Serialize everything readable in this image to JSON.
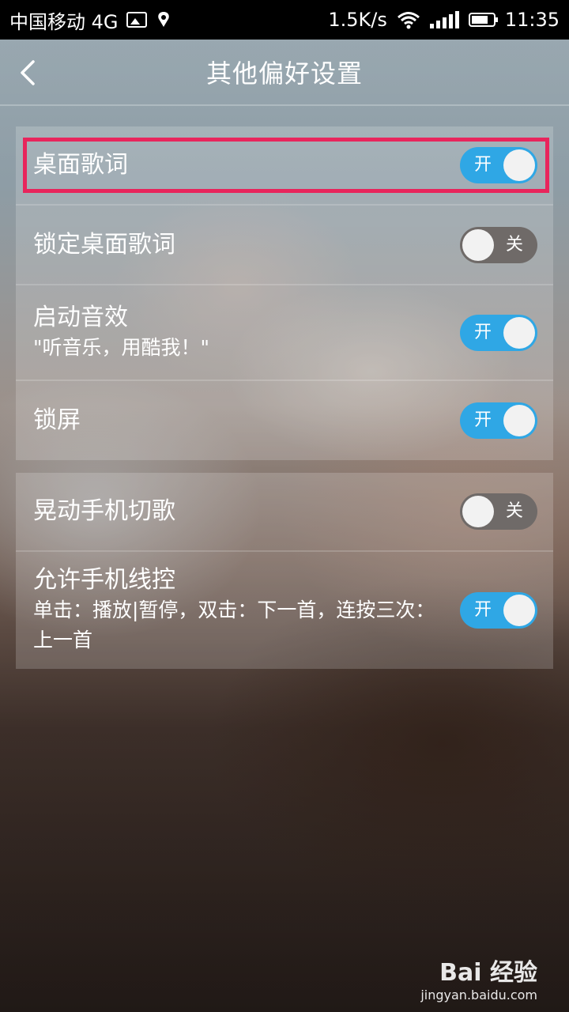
{
  "status_bar": {
    "carrier": "中国移动 4G",
    "net_speed": "1.5K/s",
    "time": "11:35"
  },
  "header": {
    "title": "其他偏好设置",
    "back_icon": "chevron-left-icon"
  },
  "group1": [
    {
      "label": "桌面歌词",
      "subtitle": "",
      "toggle_on": true,
      "toggle_text": "开"
    },
    {
      "label": "锁定桌面歌词",
      "subtitle": "",
      "toggle_on": false,
      "toggle_text": "关"
    },
    {
      "label": "启动音效",
      "subtitle": "\"听音乐，用酷我！\"",
      "toggle_on": true,
      "toggle_text": "开"
    },
    {
      "label": "锁屏",
      "subtitle": "",
      "toggle_on": true,
      "toggle_text": "开"
    }
  ],
  "group2": [
    {
      "label": "晃动手机切歌",
      "subtitle": "",
      "toggle_on": false,
      "toggle_text": "关"
    },
    {
      "label": "允许手机线控",
      "subtitle": "单击：播放|暂停，双击：下一首，连按三次：上一首",
      "toggle_on": true,
      "toggle_text": "开"
    }
  ],
  "colors": {
    "toggle_on": "#2fa7e5",
    "toggle_off": "#6f6a68",
    "highlight": "#e8255c"
  },
  "watermark": {
    "brand": "Bai 经验",
    "url": "jingyan.baidu.com"
  }
}
